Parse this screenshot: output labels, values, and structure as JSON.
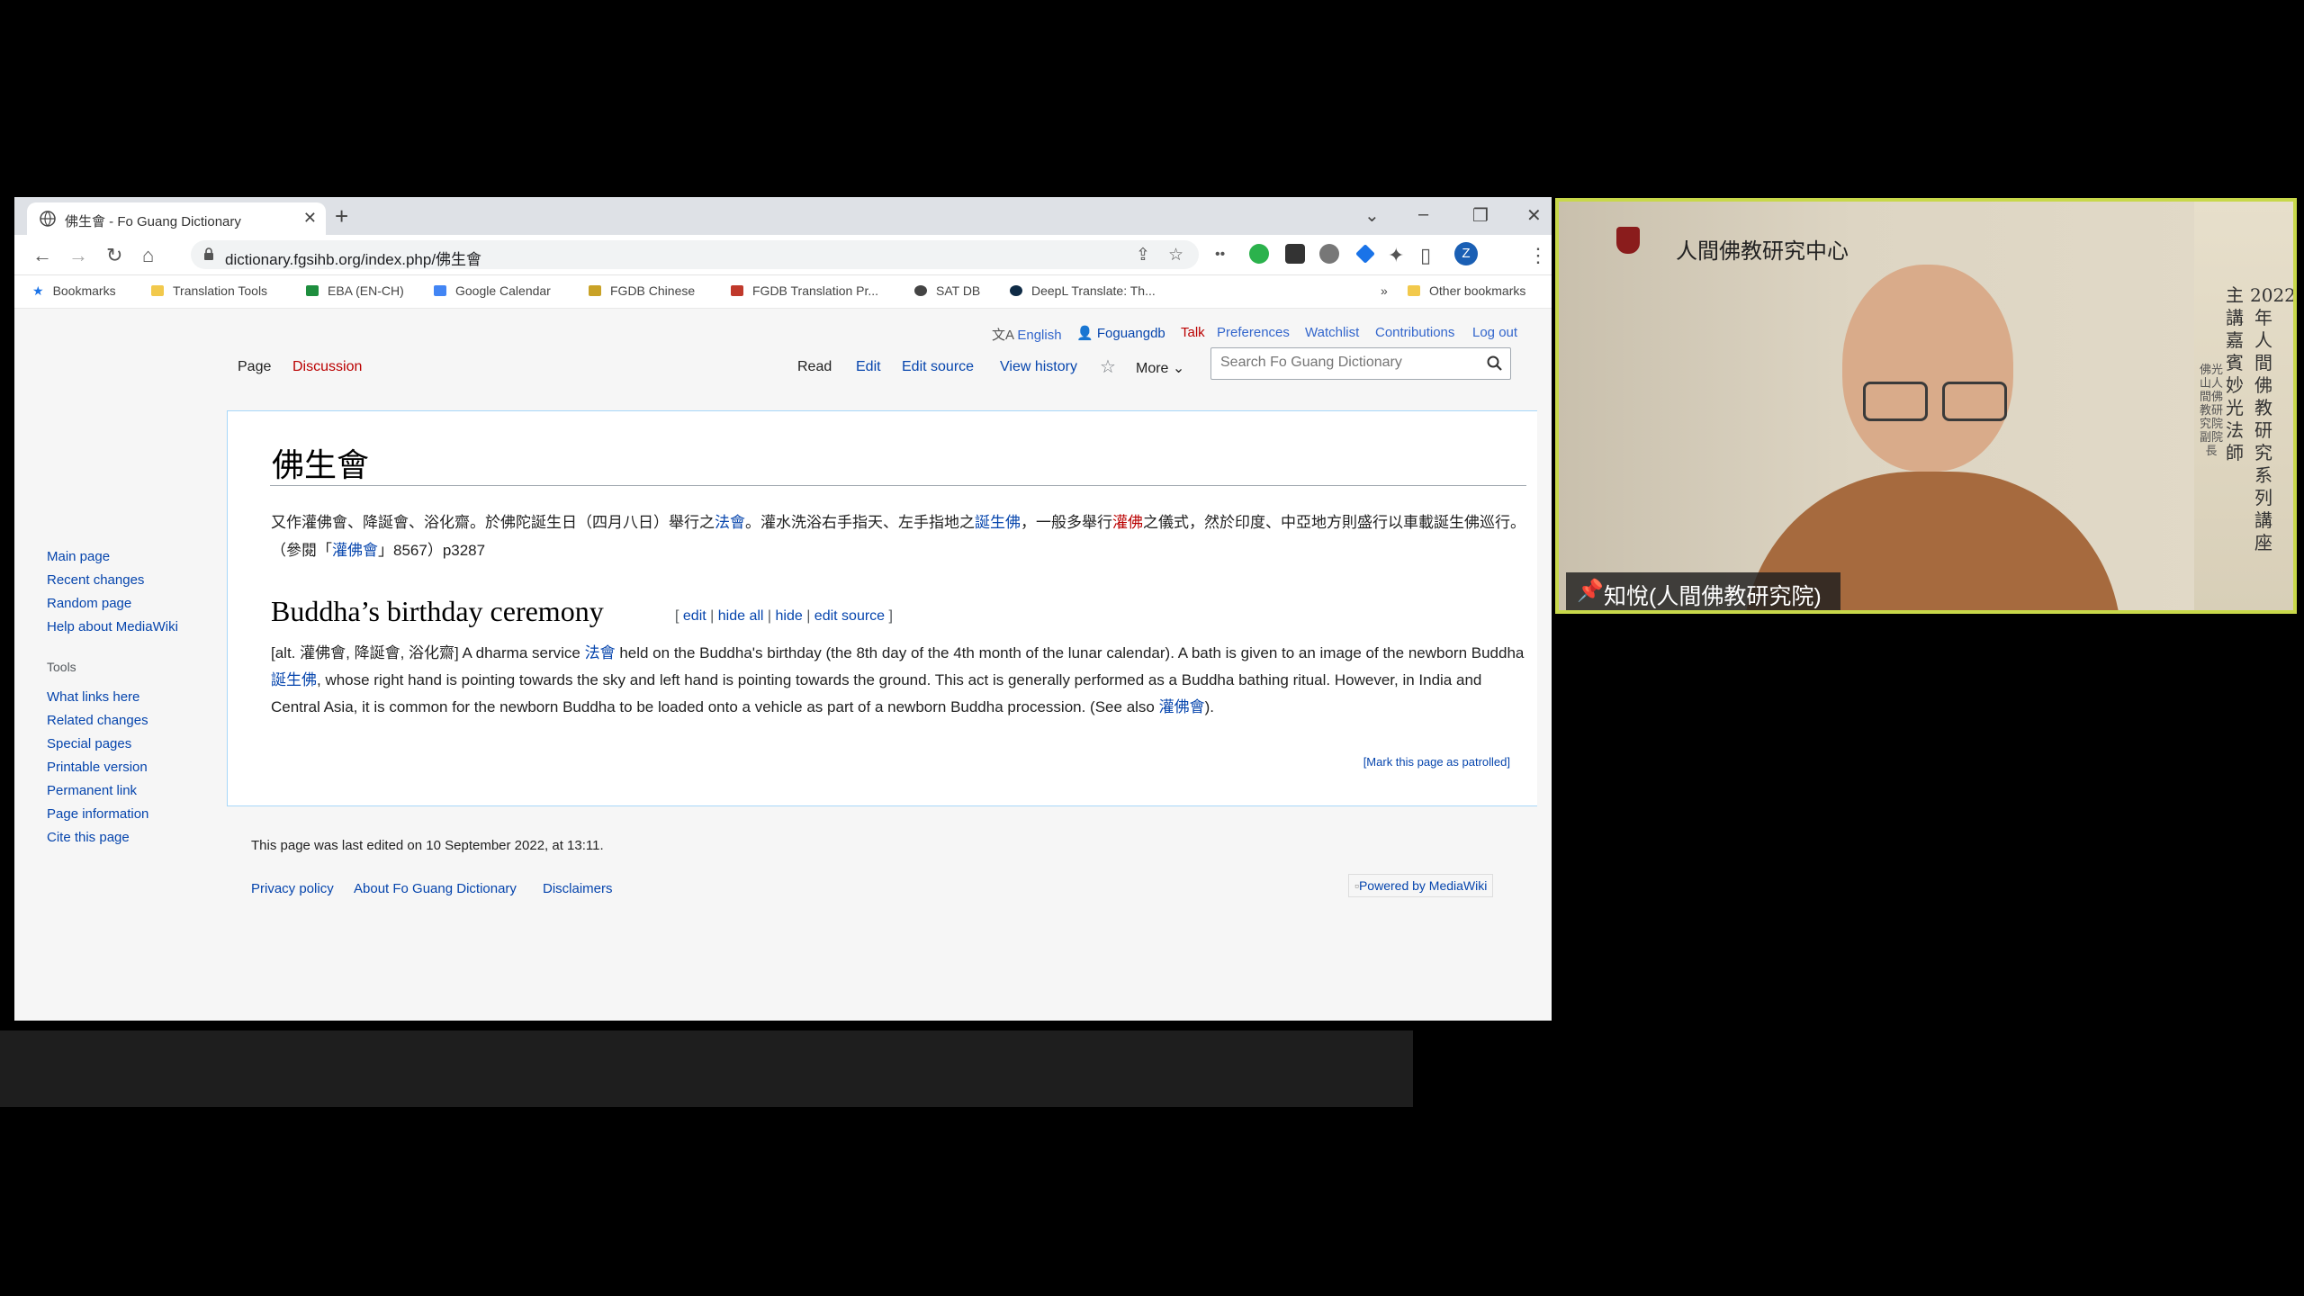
{
  "browser": {
    "tab_title": "佛生會 - Fo Guang Dictionary",
    "url": "dictionary.fgsihb.org/index.php/佛生會",
    "profile_initial": "Z",
    "bookmarks": [
      "Bookmarks",
      "Translation Tools",
      "EBA (EN-CH)",
      "Google Calendar",
      "FGDB Chinese",
      "FGDB Translation Pr...",
      "SAT DB",
      "DeepL Translate: Th..."
    ],
    "bookmarks_overflow": "»",
    "other_bookmarks": "Other bookmarks"
  },
  "wiki": {
    "personal": {
      "language": "English",
      "user": "Foguangdb",
      "talk": "Talk",
      "preferences": "Preferences",
      "watchlist": "Watchlist",
      "contributions": "Contributions",
      "logout": "Log out"
    },
    "tabs": {
      "page": "Page",
      "discussion": "Discussion",
      "read": "Read",
      "edit": "Edit",
      "edit_source": "Edit source",
      "view_history": "View history",
      "more": "More"
    },
    "search_placeholder": "Search Fo Guang Dictionary",
    "sidebar": {
      "nav": [
        "Main page",
        "Recent changes",
        "Random page",
        "Help about MediaWiki"
      ],
      "tools_heading": "Tools",
      "tools": [
        "What links here",
        "Related changes",
        "Special pages",
        "Printable version",
        "Permanent link",
        "Page information",
        "Cite this page"
      ]
    },
    "title": "佛生會",
    "zh": {
      "t1": "又作灌佛會、降誕會、浴化齋。於佛陀誕生日（四月八日）舉行之",
      "l1": "法會",
      "t2": "。灌水洗浴右手指天、左手指地之",
      "l2": "誕生佛",
      "t3": "，一般多舉行",
      "l3": "灌佛",
      "t4": "之儀式，然於印度、中亞地方則盛行以車載誕生佛巡行。（參閱「",
      "l4": "灌佛會",
      "t5": "」8567）p3287"
    },
    "section_heading": "Buddha’s birthday ceremony",
    "section_links": {
      "open": "[",
      "edit": "edit",
      "hide_all": "hide all",
      "hide": "hide",
      "edit_source": "edit source",
      "close": "]",
      "sep": " | "
    },
    "en": {
      "t1": "[alt. 灌佛會, 降誕會, 浴化齋] A dharma service ",
      "l1": "法會",
      "t2": " held on the Buddha's birthday (the 8th day of the 4th month of the lunar calendar). A bath is given to an image of the newborn Buddha ",
      "l2": "誕生佛",
      "t3": ", whose right hand is pointing towards the sky and left hand is pointing towards the ground. This act is generally performed as a Buddha bathing ritual. However, in India and Central Asia, it is common for the newborn Buddha to be loaded onto a vehicle as part of a newborn Buddha procession. (See also ",
      "l3": "灌佛會",
      "t4": ")."
    },
    "patrol": "[Mark this page as patrolled]",
    "last_edited": "This page was last edited on 10 September 2022, at 13:11.",
    "footer_links": [
      "Privacy policy",
      "About Fo Guang Dictionary",
      "Disclaimers"
    ],
    "powered_by": "Powered by MediaWiki"
  },
  "video": {
    "org_name": "人間佛教研究中心",
    "speaker_name": "知悅(人間佛教研究院)",
    "banner_col1": "2022年人間佛教研究系列講座",
    "banner_col2": "主講嘉賓",
    "banner_col3": "妙光法師",
    "banner_col4": "佛光山人間佛教研究院副院長"
  }
}
